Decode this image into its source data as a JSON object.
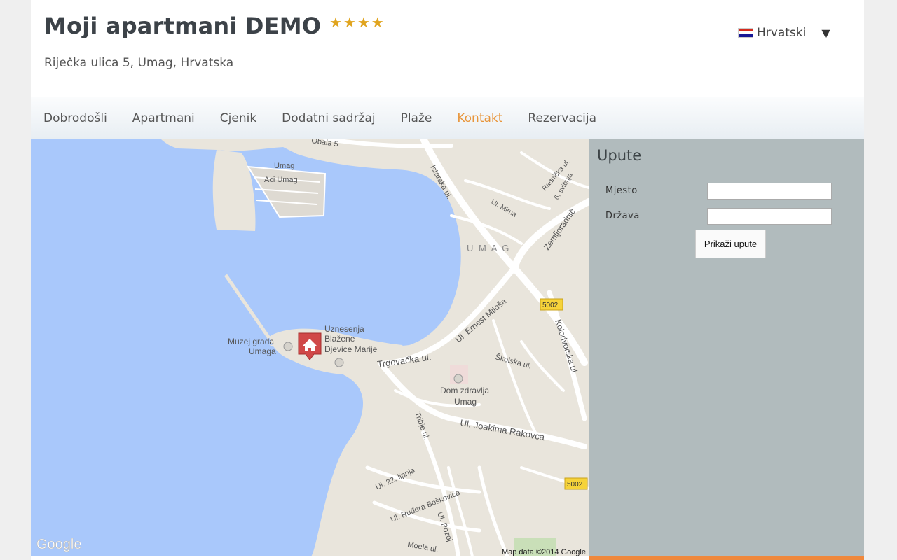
{
  "site": {
    "title": "Moji apartmani DEMO",
    "stars": "★★★★",
    "address": "Riječka ulica 5, Umag, Hrvatska",
    "language": {
      "label": "Hrvatski",
      "caret": "▼"
    }
  },
  "nav": {
    "items": [
      {
        "label": "Dobrodošli"
      },
      {
        "label": "Apartmani"
      },
      {
        "label": "Cjenik"
      },
      {
        "label": "Dodatni sadržaj"
      },
      {
        "label": "Plaže"
      },
      {
        "label": "Kontakt",
        "active": true
      },
      {
        "label": "Rezervacija"
      }
    ]
  },
  "map": {
    "labels": {
      "umag_marina": "Umag",
      "aci_umag": "Aci Umag",
      "town": "U M A G",
      "muzej_1": "Muzej grada",
      "muzej_2": "Umaga",
      "crkva_1": "Uznesenja",
      "crkva_2": "Blažene",
      "crkva_3": "Djevice Marije",
      "trgovacka": "Trgovačka ul.",
      "ernest": "Ul. Ernest Miloša",
      "kolodvorska": "Kolodvorska ul.",
      "skolska": "Školska ul.",
      "dom_1": "Dom zdravlja",
      "dom_2": "Umag",
      "joakima": "Ul. Joakima Rakovca",
      "tribje": "Tribje ul.",
      "lipnja": "Ul. 22. lipnja",
      "boskovica": "Ul. Ruđera Boškovića",
      "pozoj": "Ul. Pozoj",
      "moela": "Moela ul.",
      "mirna": "Ul. Mirna",
      "svibnja": "6. svibnja",
      "radnicka": "Radnička ul.",
      "zemljoradnicka": "Zemljoradnič",
      "istarska": "Istarska ul.",
      "obala": "Obala 5",
      "road_5002_a": "5002",
      "road_5002_b": "5002",
      "google": "Google",
      "copyright": "Map data ©2014 Google"
    }
  },
  "directions": {
    "title": "Upute",
    "mjesto_label": "Mjesto",
    "mjesto_value": "",
    "drzava_label": "Država",
    "drzava_value": "",
    "button": "Prikaži upute"
  },
  "colors": {
    "accent": "#e8953a",
    "panel_bg": "#b1bbbd",
    "water": "#a9c8fb",
    "land": "#e9e5dc",
    "marker": "#d9534f",
    "stars": "#e0a41e"
  }
}
